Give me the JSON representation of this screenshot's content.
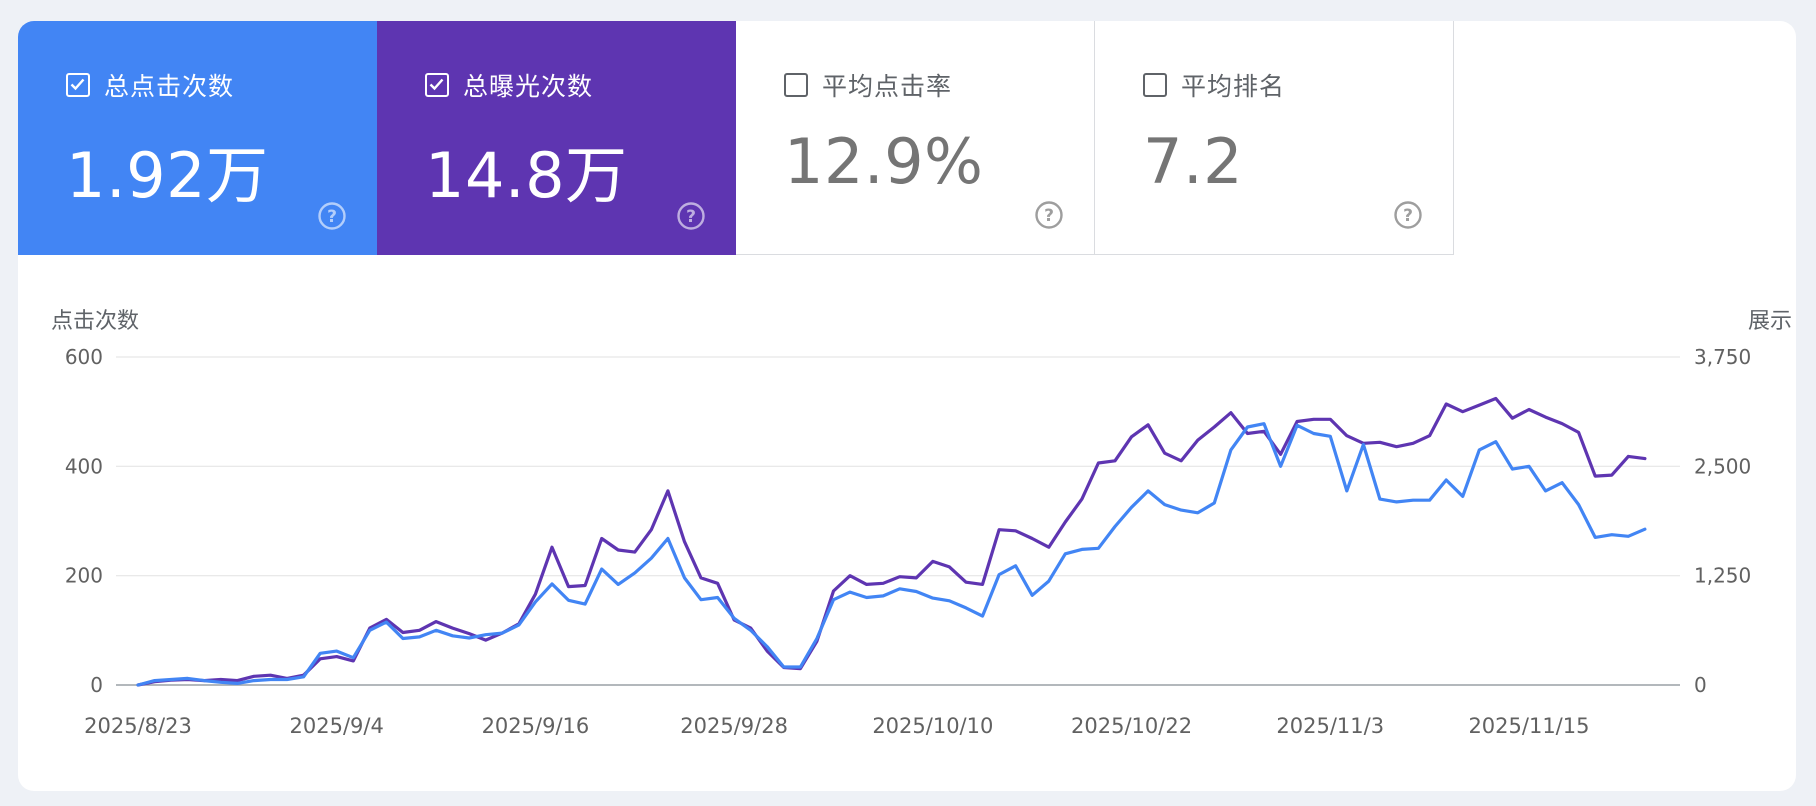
{
  "colors": {
    "clicks": "#4285f4",
    "impressions": "#5e35b1",
    "grid": "#e6e6e6",
    "axis_text": "#616161"
  },
  "metrics": [
    {
      "label": "总点击次数",
      "value": "1.92万",
      "checked": true,
      "color": "#4285f4",
      "help_icon": "help-circle-icon"
    },
    {
      "label": "总曝光次数",
      "value": "14.8万",
      "checked": true,
      "color": "#5e35b1",
      "help_icon": "help-circle-icon"
    },
    {
      "label": "平均点击率",
      "value": "12.9%",
      "checked": false,
      "color": "#ffffff",
      "help_icon": "help-circle-icon"
    },
    {
      "label": "平均排名",
      "value": "7.2",
      "checked": false,
      "color": "#ffffff",
      "help_icon": "help-circle-icon"
    }
  ],
  "chart_data": {
    "type": "line",
    "ylabel_left": "点击次数",
    "ylabel_right": "展示",
    "y_left_range": [
      0,
      600
    ],
    "y_left_ticks": [
      "0",
      "200",
      "400",
      "600"
    ],
    "y_right_range": [
      0,
      3750
    ],
    "y_right_ticks": [
      "0",
      "1,250",
      "2,500",
      "3,750"
    ],
    "x_tick_labels": [
      "2025/8/23",
      "2025/9/4",
      "2025/9/16",
      "2025/9/28",
      "2025/10/10",
      "2025/10/22",
      "2025/11/3",
      "2025/11/15"
    ],
    "x_tick_positions": [
      0,
      12,
      24,
      36,
      48,
      60,
      72,
      84
    ],
    "x_count": 94,
    "grid": true,
    "series": [
      {
        "name": "总点击次数",
        "axis": "left",
        "values": [
          0,
          8,
          10,
          12,
          8,
          5,
          3,
          8,
          10,
          10,
          15,
          58,
          62,
          50,
          100,
          115,
          85,
          88,
          100,
          90,
          86,
          92,
          95,
          110,
          152,
          185,
          155,
          148,
          212,
          184,
          205,
          232,
          268,
          196,
          156,
          160,
          122,
          100,
          70,
          33,
          33,
          85,
          156,
          170,
          160,
          163,
          176,
          171,
          159,
          154,
          141,
          126,
          202,
          218,
          164,
          190,
          240,
          248,
          250,
          290,
          325,
          355,
          330,
          320,
          315,
          333,
          430,
          472,
          478,
          400,
          475,
          460,
          455,
          355,
          440,
          340,
          335,
          338,
          338,
          375,
          345,
          430,
          445,
          395,
          400,
          355,
          370,
          330,
          270,
          275,
          272,
          285
        ]
      },
      {
        "name": "总曝光次数",
        "axis": "right",
        "values": [
          0,
          38,
          56,
          63,
          50,
          63,
          50,
          100,
          112,
          75,
          112,
          300,
          325,
          275,
          650,
          750,
          600,
          625,
          725,
          650,
          588,
          513,
          594,
          700,
          1038,
          1575,
          1125,
          1138,
          1675,
          1544,
          1519,
          1775,
          2219,
          1638,
          1225,
          1163,
          744,
          650,
          388,
          200,
          188,
          500,
          1075,
          1250,
          1150,
          1163,
          1238,
          1225,
          1413,
          1350,
          1175,
          1150,
          1775,
          1763,
          1675,
          1575,
          1863,
          2125,
          2538,
          2563,
          2838,
          2975,
          2650,
          2563,
          2800,
          2950,
          3113,
          2875,
          2900,
          2638,
          3013,
          3038,
          3038,
          2850,
          2763,
          2775,
          2725,
          2763,
          2850,
          3213,
          3125,
          3200,
          3275,
          3050,
          3150,
          3063,
          2988,
          2888,
          2388,
          2400,
          2613,
          2588
        ]
      }
    ]
  }
}
